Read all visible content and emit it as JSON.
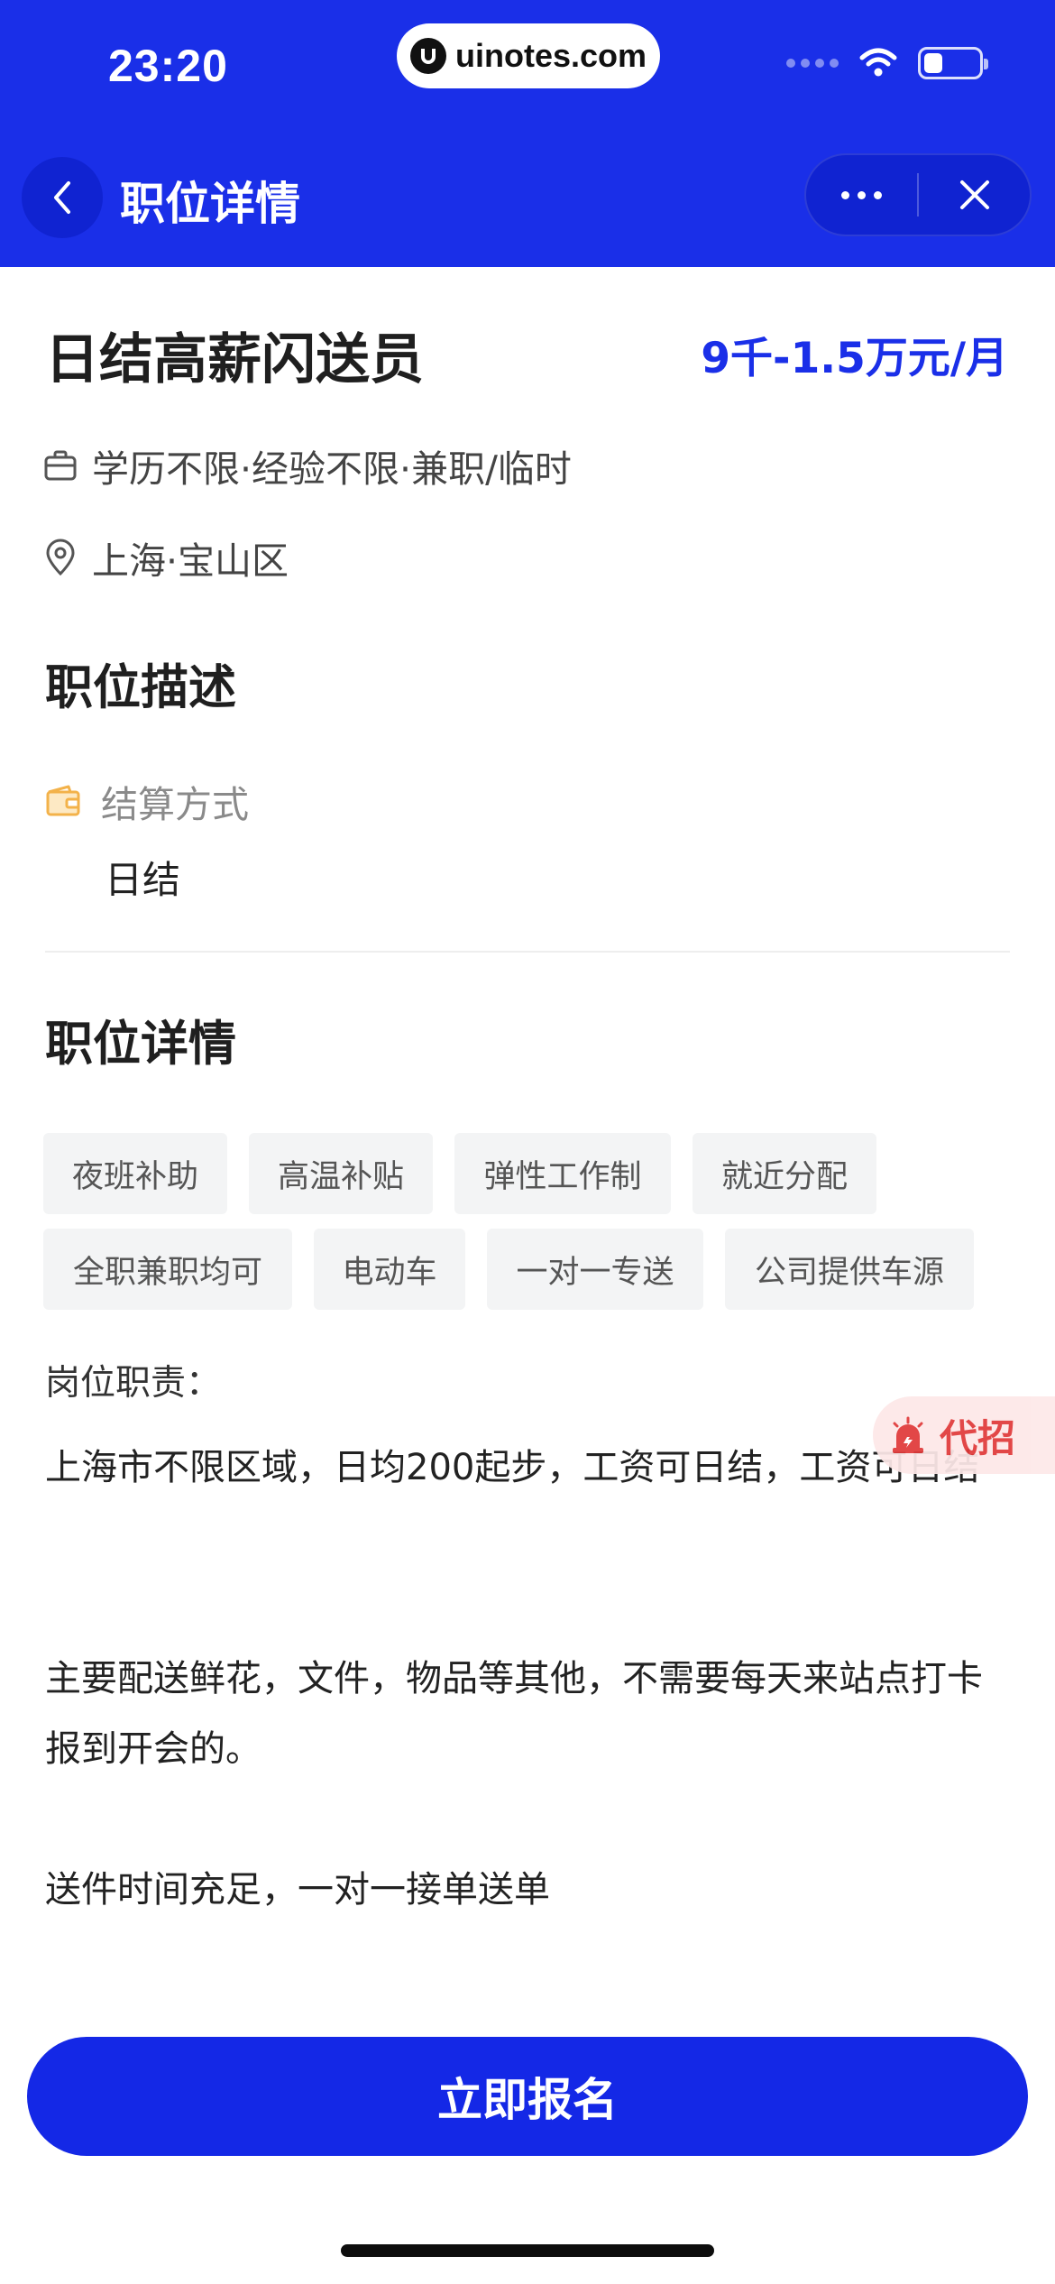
{
  "status_bar": {
    "time": "23:20",
    "watermark": "uinotes.com",
    "battery_level": 0.35
  },
  "nav": {
    "title": "职位详情"
  },
  "job": {
    "title": "日结高薪闪送员",
    "salary": "9千-1.5万元/月",
    "requirements": "学历不限·经验不限·兼职/临时",
    "location": "上海·宝山区"
  },
  "description": {
    "heading": "职位描述",
    "settlement_label": "结算方式",
    "settlement_value": "日结"
  },
  "details": {
    "heading": "职位详情",
    "tags": [
      "夜班补助",
      "高温补贴",
      "弹性工作制",
      "就近分配",
      "全职兼职均可",
      "电动车",
      "一对一专送",
      "公司提供车源"
    ],
    "duty_label": "岗位职责：",
    "paragraphs": [
      "上海市不限区域，日均200起步，工资可日结，工资可日结",
      "主要配送鲜花，文件，物品等其他，不需要每天来站点打卡报到开会的。",
      "送件时间充足，一对一接单送单"
    ]
  },
  "float_badge": {
    "label": "代招"
  },
  "cta": {
    "signup_label": "立即报名"
  },
  "colors": {
    "brand": "#1a2fe8",
    "button": "#1428e6",
    "badge_red": "#e03a3a",
    "wallet_orange": "#f3b24a"
  }
}
